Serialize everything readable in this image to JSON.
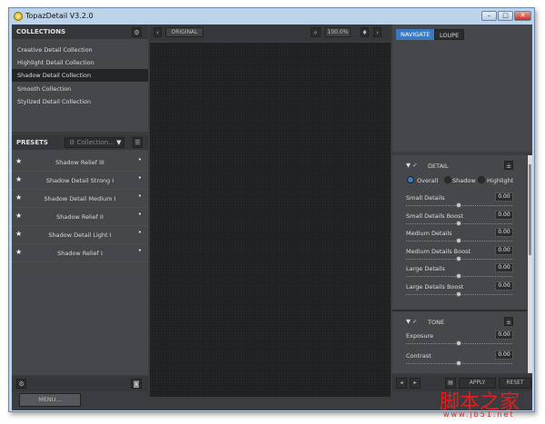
{
  "window": {
    "title": "TopazDetail V3.2.0",
    "min": "–",
    "max": "□",
    "close": "✕"
  },
  "collections": {
    "header": "COLLECTIONS",
    "items": [
      "Creative Detail Collection",
      "Highlight Detail Collection",
      "Shadow Detail Collection",
      "Smooth Collection",
      "Stylized Detail Collection"
    ],
    "selected": 2
  },
  "presets": {
    "header": "PRESETS",
    "dropdown": "Collection...",
    "items": [
      "Shadow Relief III",
      "Shadow Detail Strong I",
      "Shadow Detail Medium I",
      "Shadow Relief II",
      "Shadow Detail Light I",
      "Shadow Relief I"
    ]
  },
  "toolbar": {
    "original": "ORIGINAL",
    "zoom": "100.0%"
  },
  "navigator": {
    "tabs": [
      "NAVIGATE",
      "LOUPE"
    ],
    "active": 0
  },
  "detail": {
    "title": "DETAIL",
    "radios": [
      "Overall",
      "Shadow",
      "Highlight"
    ],
    "selected_radio": 0,
    "sliders": [
      {
        "label": "Small Details",
        "value": "0.00"
      },
      {
        "label": "Small Details Boost",
        "value": "0.00"
      },
      {
        "label": "Medium Details",
        "value": "0.00"
      },
      {
        "label": "Medium Details Boost",
        "value": "0.00"
      },
      {
        "label": "Large Details",
        "value": "0.00"
      },
      {
        "label": "Large Details Boost",
        "value": "0.00"
      }
    ]
  },
  "tone": {
    "title": "TONE",
    "sliders": [
      {
        "label": "Exposure",
        "value": "0.00"
      },
      {
        "label": "Contrast",
        "value": "0.00"
      }
    ]
  },
  "bottom": {
    "menu": "MENU...",
    "apply": "APPLY",
    "reset": "RESET"
  },
  "watermark": {
    "text": "脚本之家",
    "url": "www.jb51.net"
  },
  "colors": {
    "accent": "#3a7bbf"
  }
}
